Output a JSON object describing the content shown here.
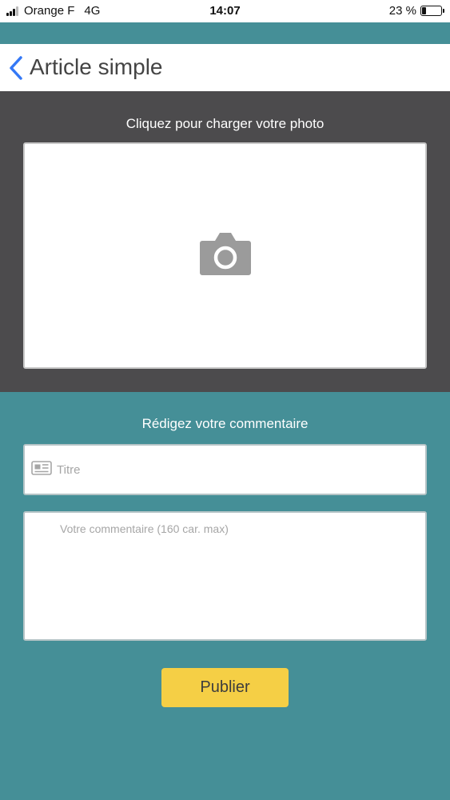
{
  "status_bar": {
    "carrier": "Orange F",
    "network": "4G",
    "time": "14:07",
    "battery": "23 %",
    "battery_level": 0.23
  },
  "nav": {
    "title": "Article simple",
    "back_icon": "chevron-left-icon",
    "accent_color": "#3478f6"
  },
  "photo": {
    "prompt": "Cliquez pour charger votre photo",
    "icon": "camera-icon"
  },
  "comment": {
    "prompt": "Rédigez votre commentaire",
    "title_placeholder": "Titre",
    "title_icon": "newspaper-icon",
    "body_placeholder": "Votre commentaire (160 car. max)"
  },
  "actions": {
    "publish_label": "Publier"
  },
  "colors": {
    "teal": "#458f97",
    "dark": "#4c4b4d",
    "publish": "#f5cf45"
  }
}
